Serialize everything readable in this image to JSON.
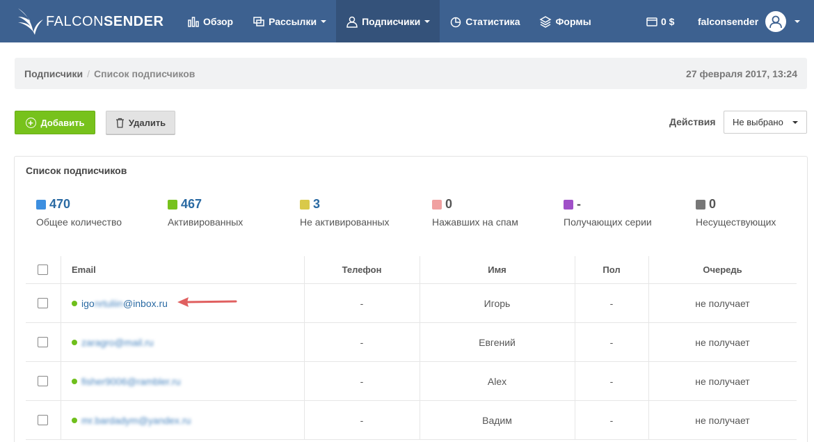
{
  "brand": {
    "part1": "FALCON",
    "part2": "SENDER"
  },
  "nav": [
    {
      "label": "Обзор",
      "icon": "chart-bars-icon",
      "dropdown": false,
      "active": false
    },
    {
      "label": "Рассылки",
      "icon": "copy-icon",
      "dropdown": true,
      "active": false
    },
    {
      "label": "Подписчики",
      "icon": "user-icon",
      "dropdown": true,
      "active": true
    },
    {
      "label": "Статистика",
      "icon": "pie-icon",
      "dropdown": false,
      "active": false
    },
    {
      "label": "Формы",
      "icon": "layers-icon",
      "dropdown": false,
      "active": false
    }
  ],
  "balance": "0 $",
  "username": "falconsender",
  "breadcrumb": {
    "parent": "Подписчики",
    "separator": "/",
    "current": "Список подписчиков",
    "date": "27 февраля 2017, 13:24"
  },
  "toolbar": {
    "add_label": "Добавить",
    "delete_label": "Удалить",
    "actions_label": "Действия",
    "actions_value": "Не выбрано"
  },
  "panel": {
    "title": "Список подписчиков"
  },
  "stats": [
    {
      "value": "470",
      "label": "Общее количество",
      "color": "#3d8fe0"
    },
    {
      "value": "467",
      "label": "Активированных",
      "color": "#77c21c"
    },
    {
      "value": "3",
      "label": "Не активированных",
      "color": "#d9c94a"
    },
    {
      "value": "0",
      "label": "Нажавших на спам",
      "color": "#f0a0a0"
    },
    {
      "value": "-",
      "label": "Получающих серии",
      "color": "#a050c8"
    },
    {
      "value": "0",
      "label": "Несуществующих",
      "color": "#777777"
    }
  ],
  "table": {
    "headers": {
      "email": "Email",
      "phone": "Телефон",
      "name": "Имя",
      "gender": "Пол",
      "queue": "Очередь"
    },
    "rows": [
      {
        "email_start": "igo",
        "email_blurred": "nrtuliin",
        "email_end": "@inbox.ru",
        "phone": "-",
        "name": "Игорь",
        "gender": "-",
        "queue": "не получает"
      },
      {
        "email_start": "",
        "email_blurred": "zaragro@mail.ru",
        "email_end": "",
        "phone": "-",
        "name": "Евгений",
        "gender": "-",
        "queue": "не получает"
      },
      {
        "email_start": "",
        "email_blurred": "fisher9006@rambler.ru",
        "email_end": "",
        "phone": "-",
        "name": "Alex",
        "gender": "-",
        "queue": "не получает"
      },
      {
        "email_start": "",
        "email_blurred": "mr.bardadym@yandex.ru",
        "email_end": "",
        "phone": "-",
        "name": "Вадим",
        "gender": "-",
        "queue": "не получает"
      }
    ]
  }
}
